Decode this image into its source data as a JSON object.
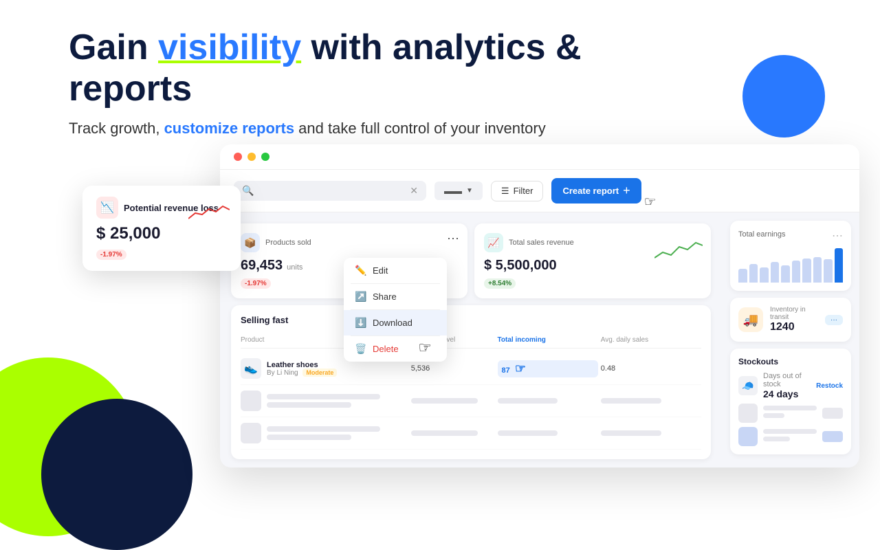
{
  "hero": {
    "title_part1": "Gain ",
    "title_highlight": "visibility",
    "title_part2": " with analytics & reports",
    "subtitle_part1": "Track growth, ",
    "subtitle_bold": "customize reports",
    "subtitle_part2": " and take full control of your inventory"
  },
  "toolbar": {
    "search_placeholder": "",
    "filter_label": "Filter",
    "create_report_label": "Create report",
    "view_icon": "≡",
    "filter_icon": "≡",
    "plus_icon": "+"
  },
  "revenue_loss_card": {
    "title": "Potential revenue loss",
    "value": "$ 25,000",
    "badge": "-1.97%"
  },
  "products_sold_card": {
    "title": "Products sold",
    "value": "69,453",
    "unit": "units",
    "badge": "-1.97%"
  },
  "total_sales_card": {
    "title": "Total sales revenue",
    "value": "$ 5,500,000",
    "badge": "+8.54%"
  },
  "total_earnings_card": {
    "title": "Total earnings",
    "bars": [
      40,
      55,
      45,
      60,
      50,
      65,
      70,
      75,
      68,
      100
    ]
  },
  "inventory_transit_card": {
    "title": "Inventory in transit",
    "value": "1240",
    "badge": "···"
  },
  "stockouts_card": {
    "title": "Stockouts",
    "item": {
      "days_label": "Days out of stock",
      "days_value": "24 days",
      "restock_label": "Restock"
    }
  },
  "context_menu": {
    "edit_label": "Edit",
    "share_label": "Share",
    "download_label": "Download",
    "delete_label": "Delete"
  },
  "table": {
    "section_title": "Selling fast",
    "columns": [
      "Product",
      "Inventory level",
      "Total incoming",
      "Avg. daily sales"
    ],
    "rows": [
      {
        "name": "Leather shoes",
        "brand": "By Li Ning",
        "badge": "Moderate",
        "inventory": "5,536",
        "incoming": "87",
        "avg_sales": "0.48",
        "icon": "👟"
      }
    ]
  }
}
